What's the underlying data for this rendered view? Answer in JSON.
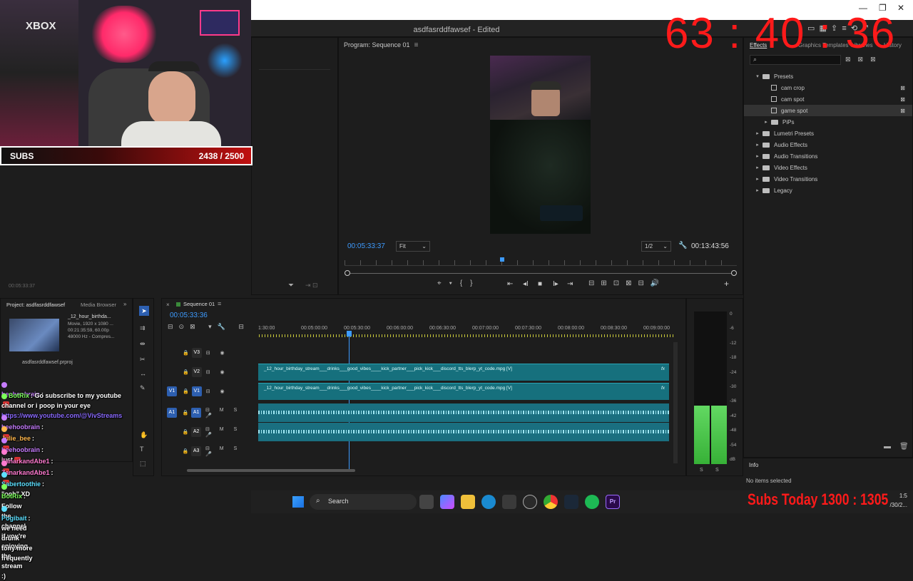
{
  "app": {
    "title": "asdfasrddfawsef - Edited"
  },
  "overlay": {
    "timer": "63 : 40 : 36",
    "subs_label": "SUBS",
    "subs_count": "2438 / 2500",
    "subs_today": "Subs Today 1300 : 1305",
    "xbox_label": "XBOX"
  },
  "source_panel": {
    "timecode": "00:05:33:37"
  },
  "program": {
    "tab": "Program: Sequence 01",
    "timecode": "00:05:33:37",
    "fit": "Fit",
    "resolution": "1/2",
    "duration": "00:13:43:56"
  },
  "effects": {
    "tabs": [
      "Effects",
      "Graphics Templates",
      "Libraries",
      "History"
    ],
    "tree": [
      {
        "label": "Presets",
        "level": 0,
        "open": true
      },
      {
        "label": "cam crop",
        "level": 1,
        "preset": true
      },
      {
        "label": "cam spot",
        "level": 1,
        "preset": true
      },
      {
        "label": "game spot",
        "level": 1,
        "preset": true,
        "selected": true
      },
      {
        "label": "PiPs",
        "level": 1
      },
      {
        "label": "Lumetri Presets",
        "level": 0
      },
      {
        "label": "Audio Effects",
        "level": 0
      },
      {
        "label": "Audio Transitions",
        "level": 0
      },
      {
        "label": "Video Effects",
        "level": 0
      },
      {
        "label": "Video Transitions",
        "level": 0
      },
      {
        "label": "Legacy",
        "level": 0
      }
    ],
    "info_tab": "Info",
    "info_text": "No items selected"
  },
  "project": {
    "tab": "Project: asdfasrddfawsef",
    "media_browser": "Media Browser",
    "clip_name": "_12_hour_birthda...",
    "clip_meta1": "Movie, 1920 x 1080 ...",
    "clip_meta2": "00:21:35:59, 60.00p",
    "clip_meta3": "48000 Hz - Compres...",
    "file": "asdfasrddfawsef.prproj"
  },
  "timeline": {
    "tab": "Sequence 01",
    "timecode": "00:05:33:36",
    "ruler": [
      "1:30:00",
      "00:05:00:00",
      "00:05:30:00",
      "00:06:00:00",
      "00:06:30:00",
      "00:07:00:00",
      "00:07:30:00",
      "00:08:00:00",
      "00:08:30:00",
      "00:09:00:00"
    ],
    "video_clip": "_12_hour_birthday_stream___drinks___good_vibes____kick_partner___pick_kick___discord_tts_blerp_yt_code.mpg [V]",
    "tracks": [
      "V3",
      "V2",
      "V1",
      "A1",
      "A2",
      "A3"
    ],
    "fx": "fx"
  },
  "meter": {
    "scale": [
      "0",
      "-6",
      "-12",
      "-18",
      "-24",
      "-30",
      "-36",
      "-42",
      "-48",
      "-54",
      "dB"
    ],
    "level": 0.62,
    "s_labels": [
      "S",
      "S"
    ]
  },
  "chat": [
    {
      "name": "heehoobrain",
      "color": "#c77dff",
      "text": ":"
    },
    {
      "name": "BotRix",
      "color": "#7bff5a",
      "text": ": Go subscribe to my youtube channel or i poop in your eye ",
      "link": "https://www.youtube.com/@VivStreams"
    },
    {
      "name": "heehoobrain",
      "color": "#c77dff",
      "text": ":"
    },
    {
      "name": "Julie_bee",
      "color": "#ffb84d",
      "text": ":"
    },
    {
      "name": "heehoobrain",
      "color": "#c77dff",
      "text": ": just"
    },
    {
      "name": "ZanarkandAbe1",
      "color": "#ff7bd0",
      "text": ":"
    },
    {
      "name": "ZanarkandAbe1",
      "color": "#ff7bd0",
      "text": ":"
    },
    {
      "name": "Sabertoothie",
      "color": "#5de0ff",
      "text": ": \"ooh\" XD"
    },
    {
      "name": "BotRix",
      "color": "#7bff5a",
      "text": ": Follow the channel if you're enjoying the stream :)"
    },
    {
      "name": "Pogibait",
      "color": "#5de0ff",
      "text": ": we need drunk tony more frequently"
    }
  ],
  "taskbar": {
    "search": "Search",
    "time": "1:5",
    "date": "/30/2..."
  }
}
